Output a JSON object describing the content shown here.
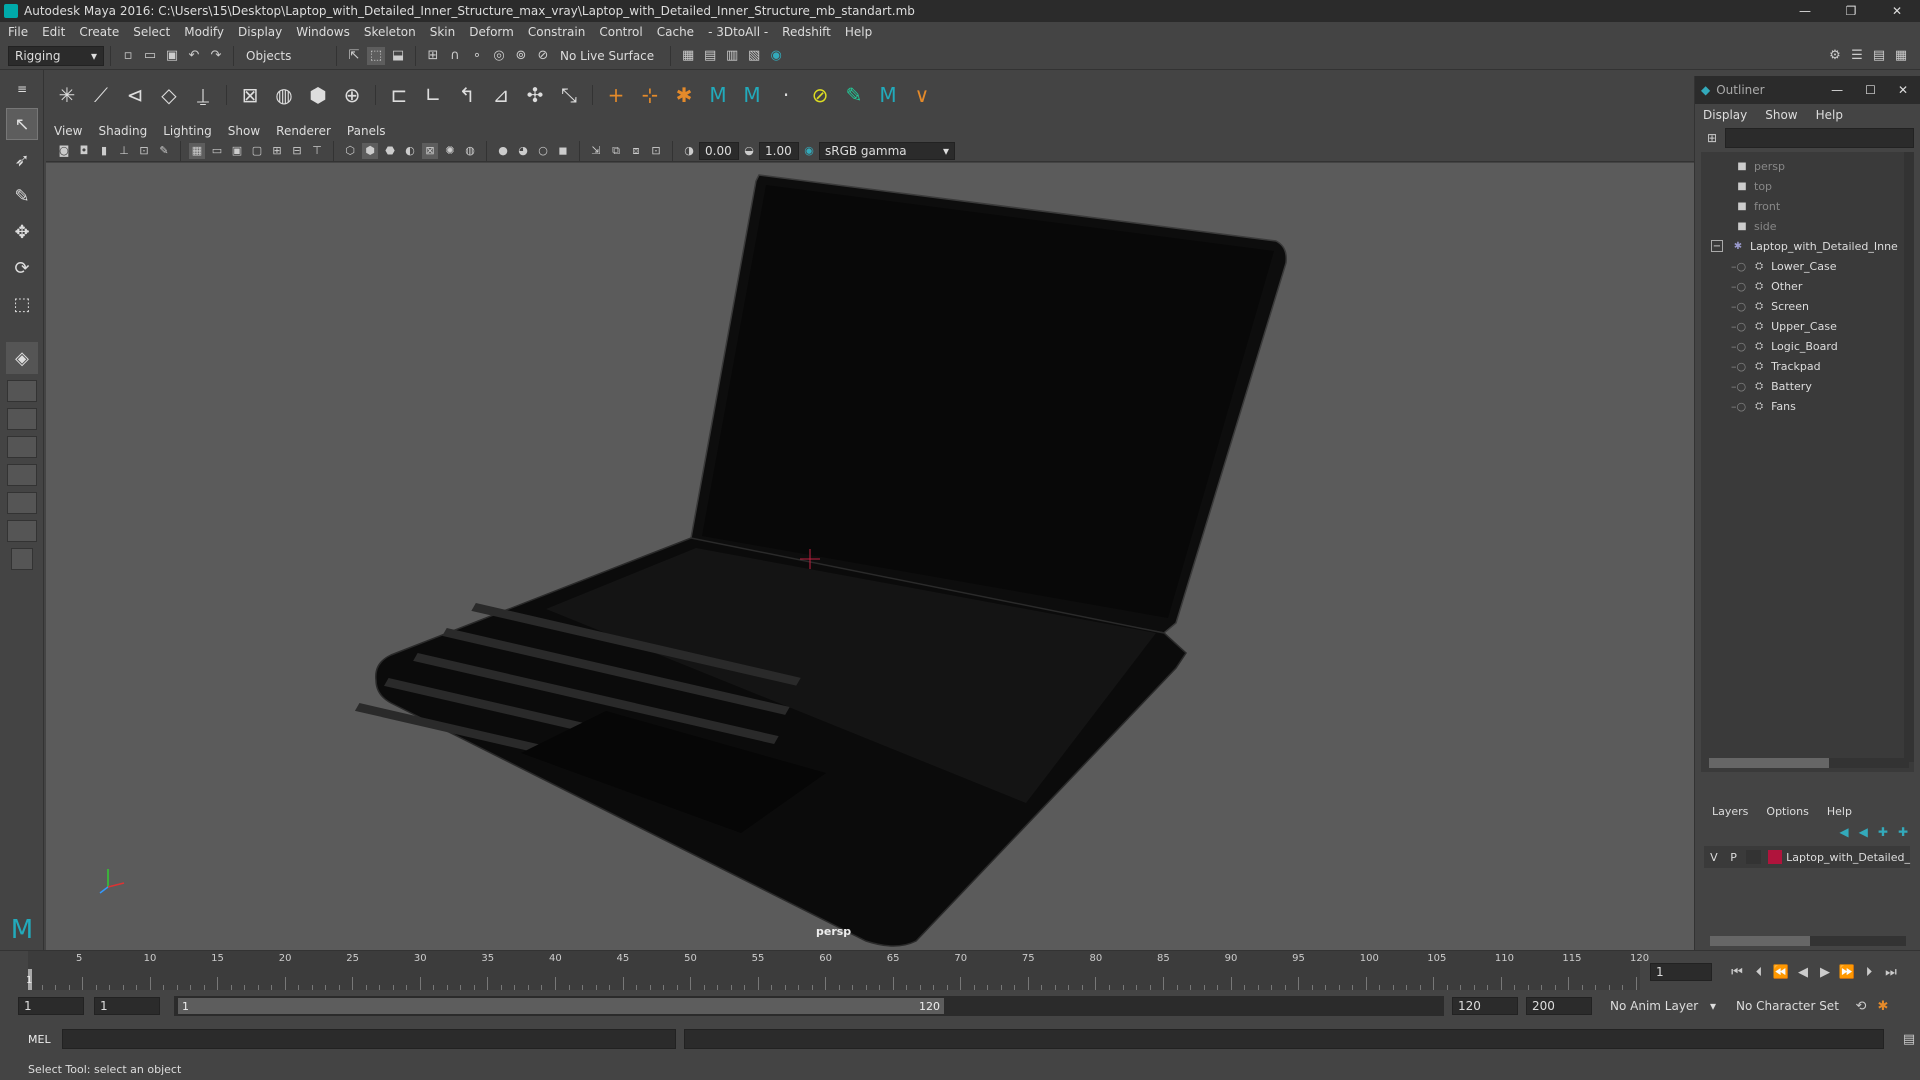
{
  "window": {
    "title": "Autodesk Maya 2016: C:\\Users\\15\\Desktop\\Laptop_with_Detailed_Inner_Structure_max_vray\\Laptop_with_Detailed_Inner_Structure_mb_standart.mb",
    "minimize": "—",
    "maximize": "❐",
    "close": "✕"
  },
  "menubar": [
    "File",
    "Edit",
    "Create",
    "Select",
    "Modify",
    "Display",
    "Windows",
    "Skeleton",
    "Skin",
    "Deform",
    "Constrain",
    "Control",
    "Cache",
    "- 3DtoAll -",
    "Redshift",
    "Help"
  ],
  "statusline": {
    "mode": "Rigging",
    "selection_mode": "Objects",
    "live_surface": "No Live Surface"
  },
  "viewport": {
    "menu": [
      "View",
      "Shading",
      "Lighting",
      "Show",
      "Renderer",
      "Panels"
    ],
    "exposure": "0.00",
    "gamma": "1.00",
    "colorspace": "sRGB gamma",
    "camera_label": "persp"
  },
  "outliner": {
    "title": "Outliner",
    "menu": [
      "Display",
      "Show",
      "Help"
    ],
    "cameras": [
      "persp",
      "top",
      "front",
      "side"
    ],
    "root": "Laptop_with_Detailed_Inne",
    "children": [
      "Lower_Case",
      "Other",
      "Screen",
      "Upper_Case",
      "Logic_Board",
      "Trackpad",
      "Battery",
      "Fans"
    ]
  },
  "layers": {
    "menu": [
      "Layers",
      "Options",
      "Help"
    ],
    "row": {
      "v": "V",
      "p": "P",
      "name": "Laptop_with_Detailed_",
      "color": "#b0143c"
    }
  },
  "timeline": {
    "ticks": [
      "5",
      "10",
      "15",
      "20",
      "25",
      "30",
      "35",
      "40",
      "45",
      "50",
      "55",
      "60",
      "65",
      "70",
      "75",
      "80",
      "85",
      "90",
      "95",
      "100",
      "105",
      "110",
      "115",
      "120"
    ],
    "start_marker": "1",
    "current_frame": "1"
  },
  "range": {
    "start": "1",
    "playback_start": "1",
    "slider_start": "1",
    "slider_end": "120",
    "playback_end": "120",
    "end": "200",
    "anim_layer": "No Anim Layer",
    "character_set": "No Character Set"
  },
  "cmdline": {
    "label": "MEL"
  },
  "help": {
    "text": "Select Tool: select an object"
  }
}
